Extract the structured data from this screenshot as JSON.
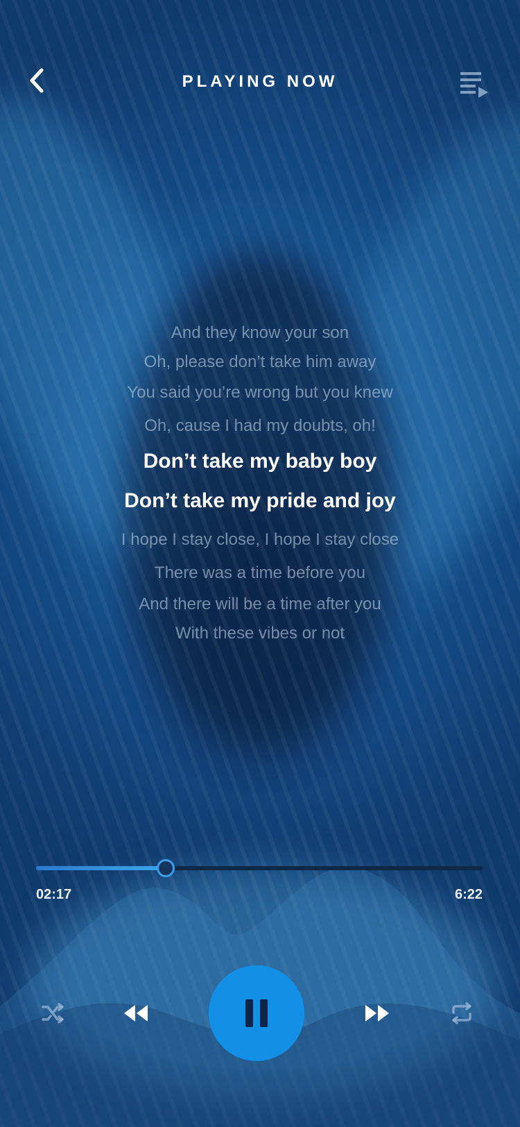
{
  "header": {
    "title": "PLAYING NOW",
    "back_icon": "chevron-left-icon",
    "queue_icon": "playlist-icon"
  },
  "lyrics": {
    "lines": [
      {
        "text": "And they know your son",
        "current": false
      },
      {
        "text": "Oh, please don’t take him away",
        "current": false
      },
      {
        "text": "You said you’re wrong but you knew",
        "current": false
      },
      {
        "text": "Oh, cause I had my doubts, oh!",
        "current": false
      },
      {
        "text": "Don’t take my baby boy",
        "current": true
      },
      {
        "text": "Don’t take my pride and joy",
        "current": true
      },
      {
        "text": "I hope I stay close, I hope I stay close",
        "current": false
      },
      {
        "text": "There was a time before you",
        "current": false
      },
      {
        "text": "And there will be a time after you",
        "current": false
      },
      {
        "text": "With these vibes or not",
        "current": false
      }
    ]
  },
  "player": {
    "elapsed": "02:17",
    "duration": "6:22",
    "progress_fraction": 0.29,
    "accent_color": "#1190e6",
    "track_color": "#0e2848"
  },
  "controls": {
    "shuffle_icon": "shuffle-icon",
    "previous_icon": "rewind-icon",
    "play_pause_icon": "pause-icon",
    "next_icon": "fast-forward-icon",
    "repeat_icon": "repeat-icon"
  }
}
